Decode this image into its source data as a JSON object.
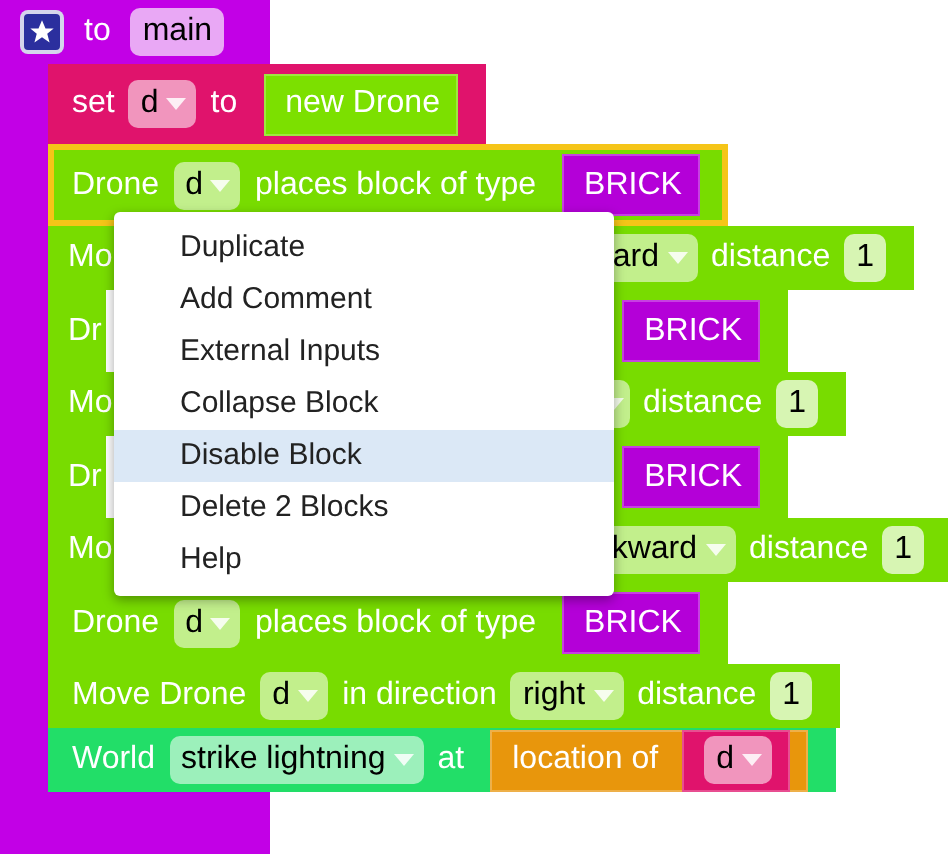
{
  "procedure": {
    "label": "to",
    "name": "main"
  },
  "statements": [
    {
      "kind": "set",
      "selected": false,
      "items": [
        {
          "kind": "text",
          "text": "set"
        },
        {
          "kind": "dropdown",
          "text": "d"
        },
        {
          "kind": "text",
          "text": "to"
        },
        {
          "kind": "value",
          "color": "#7ce000",
          "items": [
            {
              "kind": "text",
              "text": "new Drone"
            }
          ]
        }
      ]
    },
    {
      "kind": "drone",
      "selected": true,
      "items": [
        {
          "kind": "text",
          "text": "Drone"
        },
        {
          "kind": "dropdown",
          "text": "d"
        },
        {
          "kind": "text",
          "text": "places block of type"
        },
        {
          "kind": "value",
          "color": "#b400d8",
          "items": [
            {
              "kind": "text",
              "text": "BRICK"
            }
          ]
        }
      ]
    },
    {
      "kind": "move",
      "selected": false,
      "items": [
        {
          "kind": "text",
          "text": "Mo"
        }
      ],
      "right_items": [
        {
          "kind": "dropdown",
          "text": "ard"
        },
        {
          "kind": "text",
          "text": "distance"
        },
        {
          "kind": "number",
          "text": "1"
        }
      ]
    },
    {
      "kind": "drone",
      "selected": false,
      "items": [
        {
          "kind": "text",
          "text": "Dr"
        }
      ],
      "right_items": [
        {
          "kind": "value",
          "color": "#b400d8",
          "items": [
            {
              "kind": "text",
              "text": "BRICK"
            }
          ]
        }
      ]
    },
    {
      "kind": "move",
      "selected": false,
      "items": [
        {
          "kind": "text",
          "text": "Mo"
        }
      ],
      "right_items": [
        {
          "kind": "dropdown-stub"
        },
        {
          "kind": "text",
          "text": "distance"
        },
        {
          "kind": "number",
          "text": "1"
        }
      ]
    },
    {
      "kind": "drone",
      "selected": false,
      "items": [
        {
          "kind": "text",
          "text": "Dr"
        }
      ],
      "right_items": [
        {
          "kind": "value",
          "color": "#b400d8",
          "items": [
            {
              "kind": "text",
              "text": "BRICK"
            }
          ]
        }
      ]
    },
    {
      "kind": "move",
      "selected": false,
      "items": [
        {
          "kind": "text",
          "text": "Mo"
        }
      ],
      "right_items": [
        {
          "kind": "dropdown",
          "text": "kward"
        },
        {
          "kind": "text",
          "text": "distance"
        },
        {
          "kind": "number",
          "text": "1"
        }
      ]
    },
    {
      "kind": "drone",
      "selected": false,
      "items": [
        {
          "kind": "text",
          "text": "Drone"
        },
        {
          "kind": "dropdown",
          "text": "d"
        },
        {
          "kind": "text",
          "text": "places block of type"
        },
        {
          "kind": "value",
          "color": "#b400d8",
          "items": [
            {
              "kind": "text",
              "text": "BRICK"
            }
          ]
        }
      ]
    },
    {
      "kind": "move",
      "selected": false,
      "items": [
        {
          "kind": "text",
          "text": "Move Drone"
        },
        {
          "kind": "dropdown",
          "text": "d"
        },
        {
          "kind": "text",
          "text": "in direction"
        },
        {
          "kind": "dropdown",
          "text": "right"
        },
        {
          "kind": "text",
          "text": "distance"
        },
        {
          "kind": "number",
          "text": "1"
        }
      ]
    },
    {
      "kind": "world",
      "selected": false,
      "items": [
        {
          "kind": "text",
          "text": "World"
        },
        {
          "kind": "dropdown",
          "text": "strike lightning"
        },
        {
          "kind": "text",
          "text": "at"
        },
        {
          "kind": "value",
          "color": "#e8960c",
          "items": [
            {
              "kind": "text",
              "text": "location of"
            },
            {
              "kind": "value",
              "color": "#e0136c",
              "items": [
                {
                  "kind": "dropdown",
                  "text": "d"
                }
              ]
            }
          ]
        }
      ]
    }
  ],
  "context_menu": [
    {
      "label": "Duplicate",
      "selected": false
    },
    {
      "label": "Add Comment",
      "selected": false
    },
    {
      "label": "External Inputs",
      "selected": false
    },
    {
      "label": "Collapse Block",
      "selected": false
    },
    {
      "label": "Disable Block",
      "selected": true
    },
    {
      "label": "Delete 2 Blocks",
      "selected": false
    },
    {
      "label": "Help",
      "selected": false
    }
  ]
}
